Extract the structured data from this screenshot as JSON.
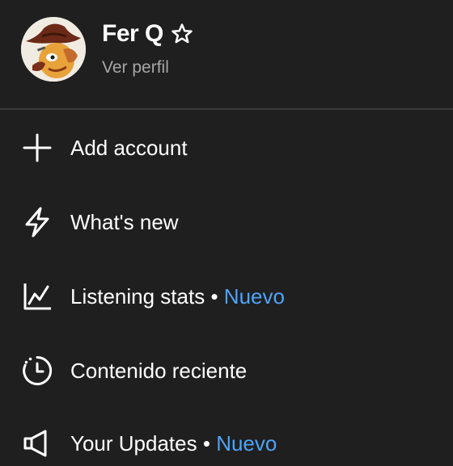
{
  "profile": {
    "name": "Fer Q",
    "view_profile_label": "Ver perfil"
  },
  "menu": {
    "items": [
      {
        "label": "Add account",
        "icon": "plus-icon"
      },
      {
        "label": "What's new",
        "icon": "lightning-icon"
      },
      {
        "label": "Listening stats",
        "icon": "line-chart-icon",
        "separator": "•",
        "badge": "Nuevo"
      },
      {
        "label": "Contenido reciente",
        "icon": "history-clock-icon"
      },
      {
        "label": "Your Updates",
        "icon": "megaphone-icon",
        "separator": "•",
        "badge": "Nuevo"
      }
    ]
  },
  "colors": {
    "background": "#1f1f1f",
    "text": "#ffffff",
    "muted": "#a7a7a7",
    "accent_new": "#4fa3f7",
    "divider": "#3a3a3a"
  }
}
